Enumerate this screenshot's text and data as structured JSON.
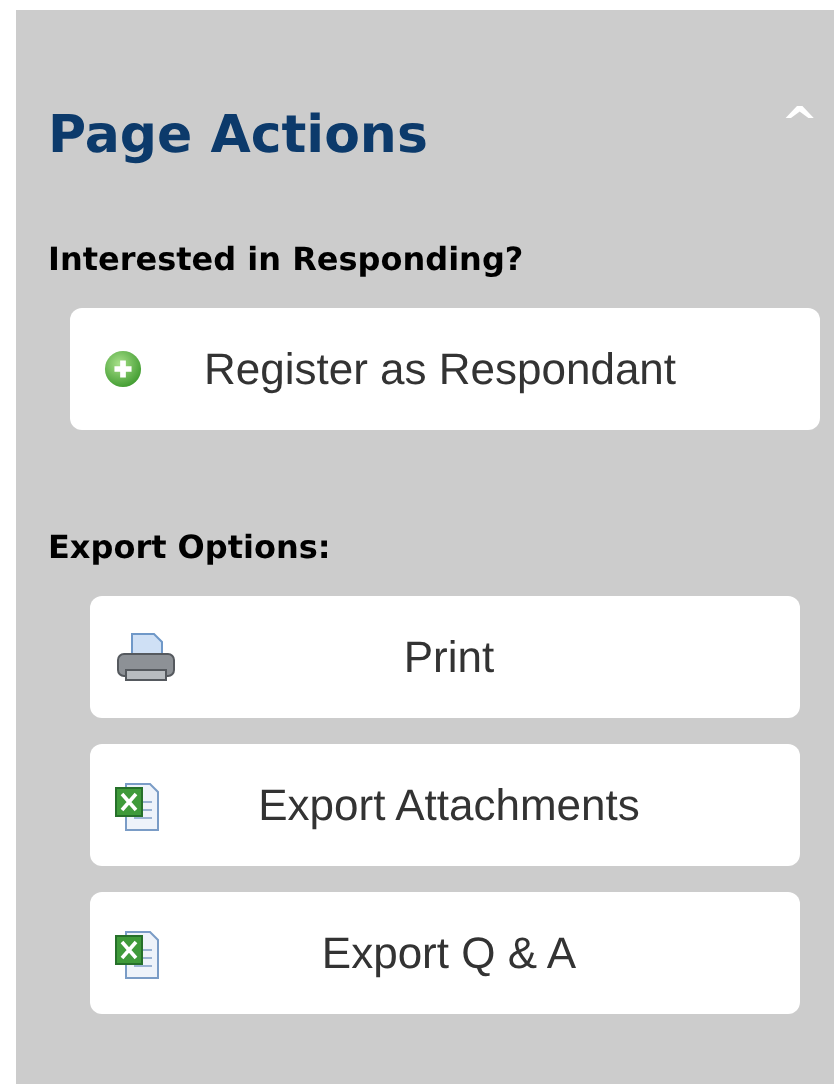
{
  "panel": {
    "title": "Page Actions",
    "collapse_icon": "^",
    "expanded": true
  },
  "sections": [
    {
      "heading": "Interested in Responding?",
      "buttons": [
        {
          "label": "Register as Respondant",
          "kind": "add"
        }
      ]
    },
    {
      "heading": "Export Options:",
      "buttons": [
        {
          "label": "Print",
          "kind": "printer"
        },
        {
          "label": "Export Attachments",
          "kind": "spreadsheet"
        },
        {
          "label": "Export Q & A",
          "kind": "spreadsheet"
        }
      ]
    }
  ]
}
